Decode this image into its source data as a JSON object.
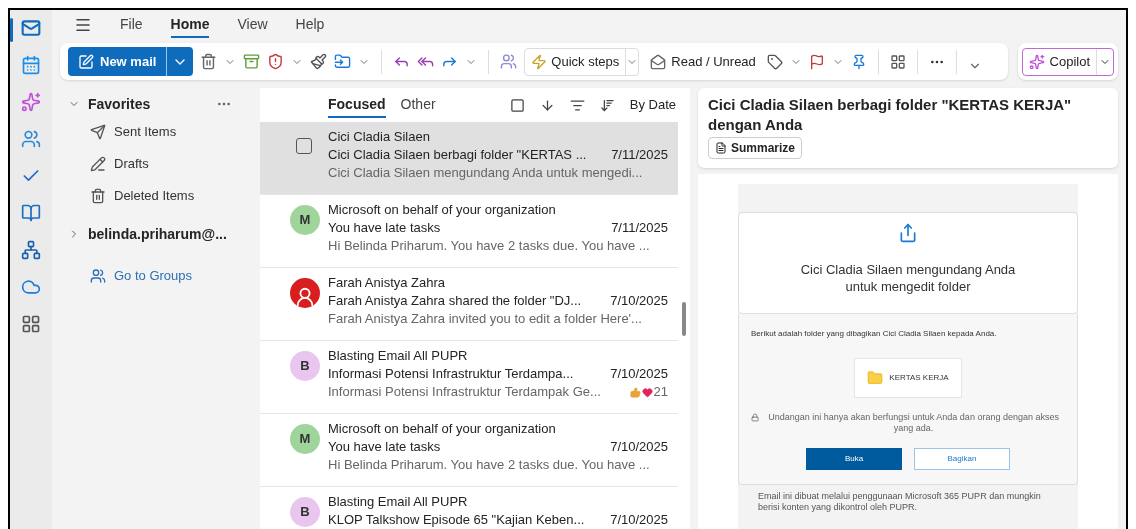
{
  "app_rail": [
    {
      "kind": "mail",
      "selected": true
    },
    {
      "kind": "calendar",
      "selected": false
    },
    {
      "kind": "copilot",
      "selected": false
    },
    {
      "kind": "people",
      "selected": false
    },
    {
      "kind": "todo",
      "selected": false
    },
    {
      "kind": "notes",
      "selected": false
    },
    {
      "kind": "org",
      "selected": false
    },
    {
      "kind": "cloud",
      "selected": false
    },
    {
      "kind": "apps",
      "selected": false
    }
  ],
  "menu_tabs": [
    {
      "label": "File",
      "selected": false
    },
    {
      "label": "Home",
      "selected": true
    },
    {
      "label": "View",
      "selected": false
    },
    {
      "label": "Help",
      "selected": false
    }
  ],
  "toolbar": {
    "new_mail": "New mail",
    "quick_steps": "Quick steps",
    "read_unread": "Read / Unread",
    "copilot": "Copilot"
  },
  "favorites": {
    "label": "Favorites",
    "expanded": true,
    "items": [
      {
        "kind": "sent",
        "label": "Sent Items"
      },
      {
        "kind": "drafts",
        "label": "Drafts"
      },
      {
        "kind": "deleted",
        "label": "Deleted Items"
      }
    ]
  },
  "account": {
    "label": "belinda.priharum@...",
    "expanded": false
  },
  "groups_link": "Go to Groups",
  "list_tabs": [
    {
      "label": "Focused",
      "selected": true
    },
    {
      "label": "Other",
      "selected": false
    }
  ],
  "sort_label": "By Date",
  "messages": [
    {
      "selected": true,
      "sender": "Cici Cladia Silaen",
      "subject": "Cici Cladia Silaen berbagi folder \"KERTAS ...",
      "date": "7/11/2025",
      "preview": "Cici Cladia Silaen mengundang Anda untuk mengedi..."
    },
    {
      "selected": false,
      "avatar": {
        "kind": "letter",
        "letter": "M",
        "color": "#9fd59a"
      },
      "sender": "Microsoft on behalf of your organization",
      "subject": "You have late tasks",
      "date": "7/11/2025",
      "preview": "Hi Belinda Priharum. You have 2 tasks due. You have ..."
    },
    {
      "selected": false,
      "avatar": {
        "kind": "photo",
        "color": "#d81e1e"
      },
      "sender": "Farah Anistya Zahra",
      "subject": "Farah Anistya Zahra shared the folder \"DJ...",
      "date": "7/10/2025",
      "preview": "Farah Anistya Zahra invited you to edit a folder Here'..."
    },
    {
      "selected": false,
      "avatar": {
        "kind": "letter",
        "letter": "B",
        "color": "#e8c6ee"
      },
      "sender": "Blasting Email All PUPR",
      "subject": "Informasi Potensi Infrastruktur Terdampa...",
      "date": "7/10/2025",
      "preview": "Informasi Potensi Infrastruktur Terdampak Ge...",
      "reactions": "21"
    },
    {
      "selected": false,
      "avatar": {
        "kind": "letter",
        "letter": "M",
        "color": "#9fd59a"
      },
      "sender": "Microsoft on behalf of your organization",
      "subject": "You have late tasks",
      "date": "7/10/2025",
      "preview": "Hi Belinda Priharum. You have 2 tasks due. You have ..."
    },
    {
      "selected": false,
      "avatar": {
        "kind": "letter",
        "letter": "B",
        "color": "#e8c6ee"
      },
      "sender": "Blasting Email All PUPR",
      "subject": "KLOP Talkshow Episode 65 \"Kajian Keben...",
      "date": "7/10/2025"
    }
  ],
  "reading": {
    "subject": "Cici Cladia Silaen berbagi folder \"KERTAS KERJA\" dengan Anda",
    "summarize": "Summarize",
    "card_title": "Cici Cladia Silaen mengundang Anda untuk mengedit folder",
    "intro": "Berikut adalah folder yang dibagikan Cici Cladia Silaen kepada Anda.",
    "folder_name": "KERTAS KERJA",
    "notice": "Undangan ini hanya akan berfungsi untuk Anda dan orang dengan akses yang ada.",
    "buttons": [
      {
        "kind": "primary",
        "label": "Buka"
      },
      {
        "kind": "secondary",
        "label": "Bagikan"
      }
    ],
    "footer": "Email ini dibuat melalui penggunaan Microsoft 365 PUPR dan mungkin berisi konten yang dikontrol oleh PUPR."
  }
}
